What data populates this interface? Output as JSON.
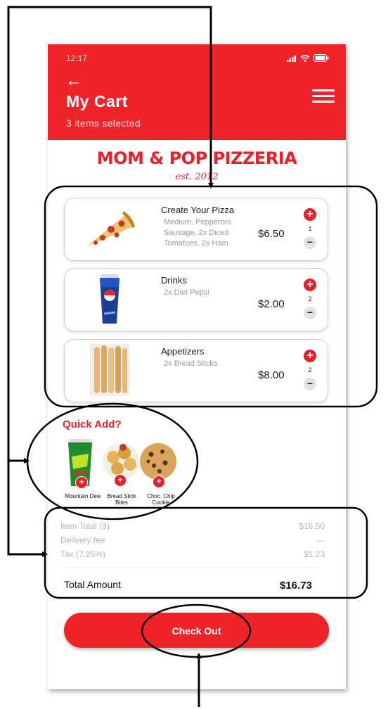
{
  "status": {
    "time": "12:17"
  },
  "header": {
    "title": "My Cart",
    "subtitle": "3 items selected"
  },
  "brand": {
    "name": "MOM & POP PIZZERIA",
    "est": "est. 2012"
  },
  "cart_items": [
    {
      "name": "Create Your Pizza",
      "description": "Medium, Pepperoni, Sausage, 2x Diced Tomatoes, 2x Ham",
      "price": "$6.50",
      "qty": "1",
      "image_icon": "pizza-slice-icon"
    },
    {
      "name": "Drinks",
      "description": "2x Diet Pepsi",
      "price": "$2.00",
      "qty": "2",
      "image_icon": "soda-cup-icon"
    },
    {
      "name": "Appetizers",
      "description": "2x Bread Sticks",
      "price": "$8.00",
      "qty": "2",
      "image_icon": "breadsticks-icon"
    }
  ],
  "quick_add": {
    "title": "Quick Add?",
    "items": [
      {
        "label": "Mountain Dew",
        "image_icon": "mountain-dew-cup-icon"
      },
      {
        "label": "Bread Stick Bites",
        "image_icon": "bread-bites-icon"
      },
      {
        "label": "Choc. Chip Cookie",
        "image_icon": "cookie-icon"
      }
    ]
  },
  "summary": {
    "item_total_label": "Item Total (3)",
    "item_total_value": "$16.50",
    "delivery_label": "Delivery fee",
    "delivery_value": "—",
    "tax_label": "Tax (7.25%)",
    "tax_value": "$1.23",
    "total_label": "Total Amount",
    "total_value": "$16.73"
  },
  "checkout_label": "Check Out",
  "colors": {
    "accent": "#f0222a",
    "brand_text": "#e8202a",
    "muted_text": "#b5b5b5"
  }
}
